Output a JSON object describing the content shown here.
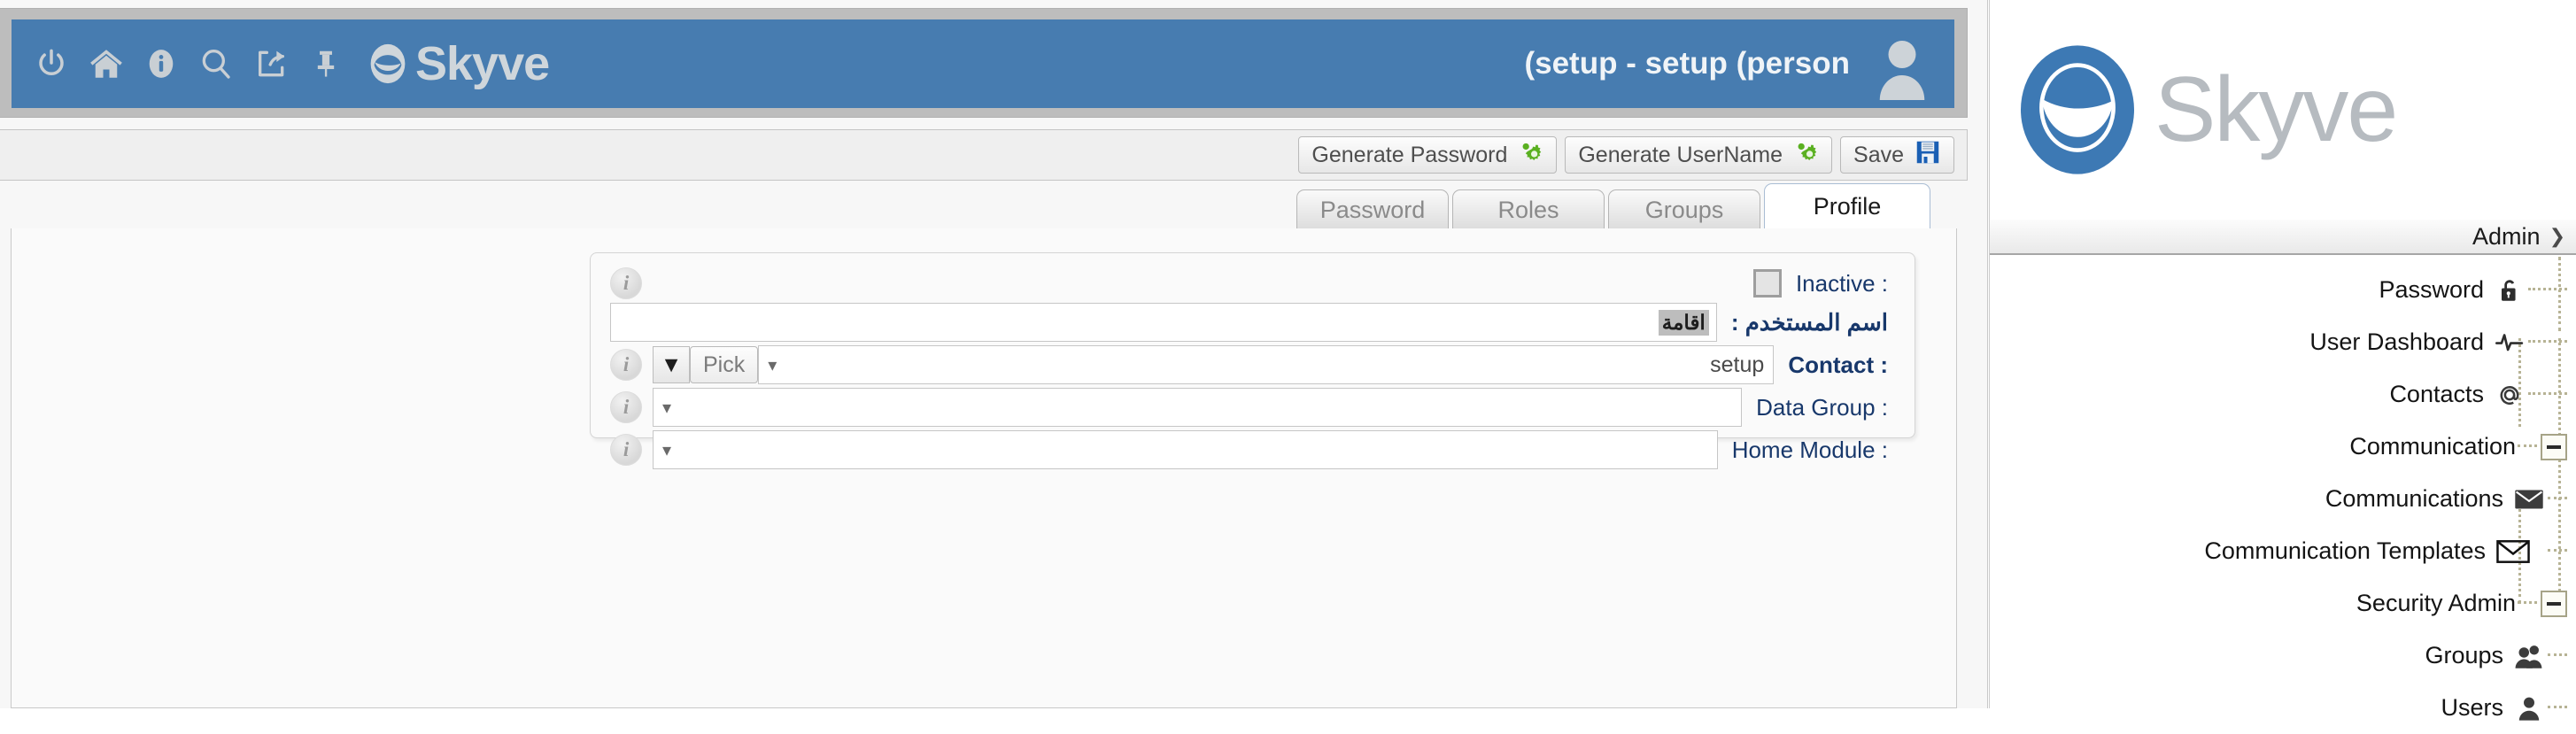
{
  "header": {
    "title": "(setup - setup (person",
    "brand": "Skyve",
    "icons": [
      {
        "name": "power-icon"
      },
      {
        "name": "home-icon"
      },
      {
        "name": "info-icon"
      },
      {
        "name": "search-icon"
      },
      {
        "name": "share-icon"
      },
      {
        "name": "pin-icon"
      }
    ],
    "avatar_name": "user-avatar",
    "accent_color": "#477cb0"
  },
  "toolbar": {
    "buttons": [
      {
        "label": "Generate Password",
        "icon": "gear-icon"
      },
      {
        "label": "Generate UserName",
        "icon": "gear-icon"
      },
      {
        "label": "Save",
        "icon": "floppy-disk-icon"
      }
    ]
  },
  "tabs": [
    {
      "label": "Password",
      "active": false
    },
    {
      "label": "Roles",
      "active": false
    },
    {
      "label": "Groups",
      "active": false
    },
    {
      "label": "Profile",
      "active": true
    }
  ],
  "form": {
    "rows": [
      {
        "type": "checkbox",
        "label": ": Inactive",
        "checked": false,
        "info": "i"
      },
      {
        "type": "text",
        "label": "اسم المستخدم :",
        "value": "اقامة",
        "info": "i"
      },
      {
        "type": "lookup",
        "label": ": Contact",
        "value": "setup",
        "pick_label": "Pick",
        "info": "i"
      },
      {
        "type": "combo",
        "label": ": Data Group",
        "value": "",
        "info": "i"
      },
      {
        "type": "combo",
        "label": ": Home Module",
        "value": "",
        "info": "i"
      }
    ]
  },
  "right_panel": {
    "logo_text": "Skyve",
    "section_label": "Admin",
    "nav_items": [
      {
        "label": "Password",
        "icon": "lock-icon",
        "expandable": false,
        "indent": 0
      },
      {
        "label": "User Dashboard",
        "icon": "pulse-icon",
        "expandable": false,
        "indent": 0
      },
      {
        "label": "Contacts",
        "icon": "at-sign-icon",
        "expandable": false,
        "indent": 0
      },
      {
        "label": "Communication",
        "icon": "none",
        "expandable": true,
        "indent": 0
      },
      {
        "label": "Communications",
        "icon": "envelope-filled-icon",
        "expandable": false,
        "indent": 1
      },
      {
        "label": "Communication Templates",
        "icon": "envelope-outline-icon",
        "expandable": false,
        "indent": 1
      },
      {
        "label": "Security Admin",
        "icon": "none",
        "expandable": true,
        "indent": 0
      },
      {
        "label": "Groups",
        "icon": "users-icon",
        "expandable": false,
        "indent": 1
      },
      {
        "label": "Users",
        "icon": "user-icon",
        "expandable": false,
        "indent": 1
      }
    ]
  }
}
